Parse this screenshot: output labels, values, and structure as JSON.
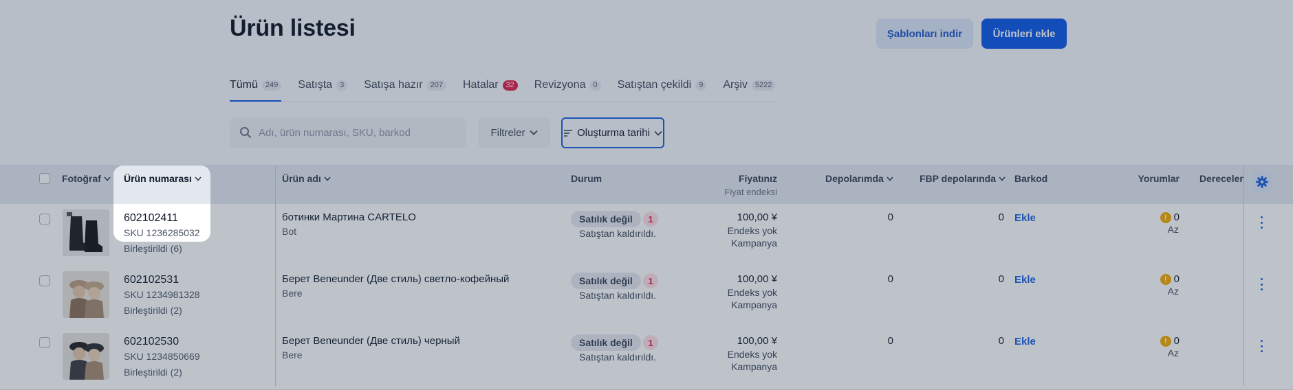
{
  "header": {
    "title": "Ürün listesi",
    "download_templates": "Şablonları indir",
    "add_products": "Ürünleri ekle"
  },
  "tabs": [
    {
      "label": "Tümü",
      "count": "249"
    },
    {
      "label": "Satışta",
      "count": "3"
    },
    {
      "label": "Satışa hazır",
      "count": "207"
    },
    {
      "label": "Hatalar",
      "count": "32"
    },
    {
      "label": "Revizyona",
      "count": "0"
    },
    {
      "label": "Satıştan çekildi",
      "count": "9"
    },
    {
      "label": "Arşiv",
      "count": "5222"
    }
  ],
  "search": {
    "placeholder": "Adı, ürün numarası, SKU, barkod",
    "value": ""
  },
  "filters": {
    "label": "Filtreler"
  },
  "sort": {
    "label": "Oluşturma tarihi"
  },
  "table": {
    "columns": {
      "photo": "Fotoğraf",
      "product_number": "Ürün numarası",
      "product_name": "Ürün adı",
      "status": "Durum",
      "price": "Fiyatınız",
      "price_sub": "Fiyat endeksi",
      "warehouses": "Depolarımda",
      "fbp": "FBP depolarında",
      "barcode": "Barkod",
      "reviews": "Yorumlar",
      "rating": "Derecelen"
    },
    "rows": [
      {
        "product_number": "602102411",
        "sku": "SKU 1236285032",
        "merged": "Birleştirildi (6)",
        "name": "ботинки Мартина CARTELO",
        "type": "Bot",
        "status": "Satılık değil",
        "status_count": "1",
        "status_sub": "Satıştan kaldırıldı.",
        "price": "100,00 ¥",
        "index": "Endeks yok",
        "campaign": "Kampanya",
        "warehouses": "0",
        "fbp": "0",
        "barcode_action": "Ekle",
        "reviews": "0",
        "reviews_sub": "Az"
      },
      {
        "product_number": "602102531",
        "sku": "SKU 1234981328",
        "merged": "Birleştirildi (2)",
        "name": "Берет Beneunder (Две стиль) светло-кофейный",
        "type": "Bere",
        "status": "Satılık değil",
        "status_count": "1",
        "status_sub": "Satıştan kaldırıldı.",
        "price": "100,00 ¥",
        "index": "Endeks yok",
        "campaign": "Kampanya",
        "warehouses": "0",
        "fbp": "0",
        "barcode_action": "Ekle",
        "reviews": "0",
        "reviews_sub": "Az"
      },
      {
        "product_number": "602102530",
        "sku": "SKU 1234850669",
        "merged": "Birleştirildi (2)",
        "name": "Берет Beneunder (Две стиль) черный",
        "type": "Bere",
        "status": "Satılık değil",
        "status_count": "1",
        "status_sub": "Satıştan kaldırıldı.",
        "price": "100,00 ¥",
        "index": "Endeks yok",
        "campaign": "Kampanya",
        "warehouses": "0",
        "fbp": "0",
        "barcode_action": "Ekle",
        "reviews": "0",
        "reviews_sub": "Az"
      }
    ]
  },
  "colors": {
    "accent": "#0a57e9",
    "error": "#e11d48",
    "warning": "#f2a900"
  },
  "icons": [
    "search-icon",
    "chevron-down-icon",
    "sort-icon",
    "gear-icon",
    "kebab-icon",
    "warning-icon"
  ]
}
